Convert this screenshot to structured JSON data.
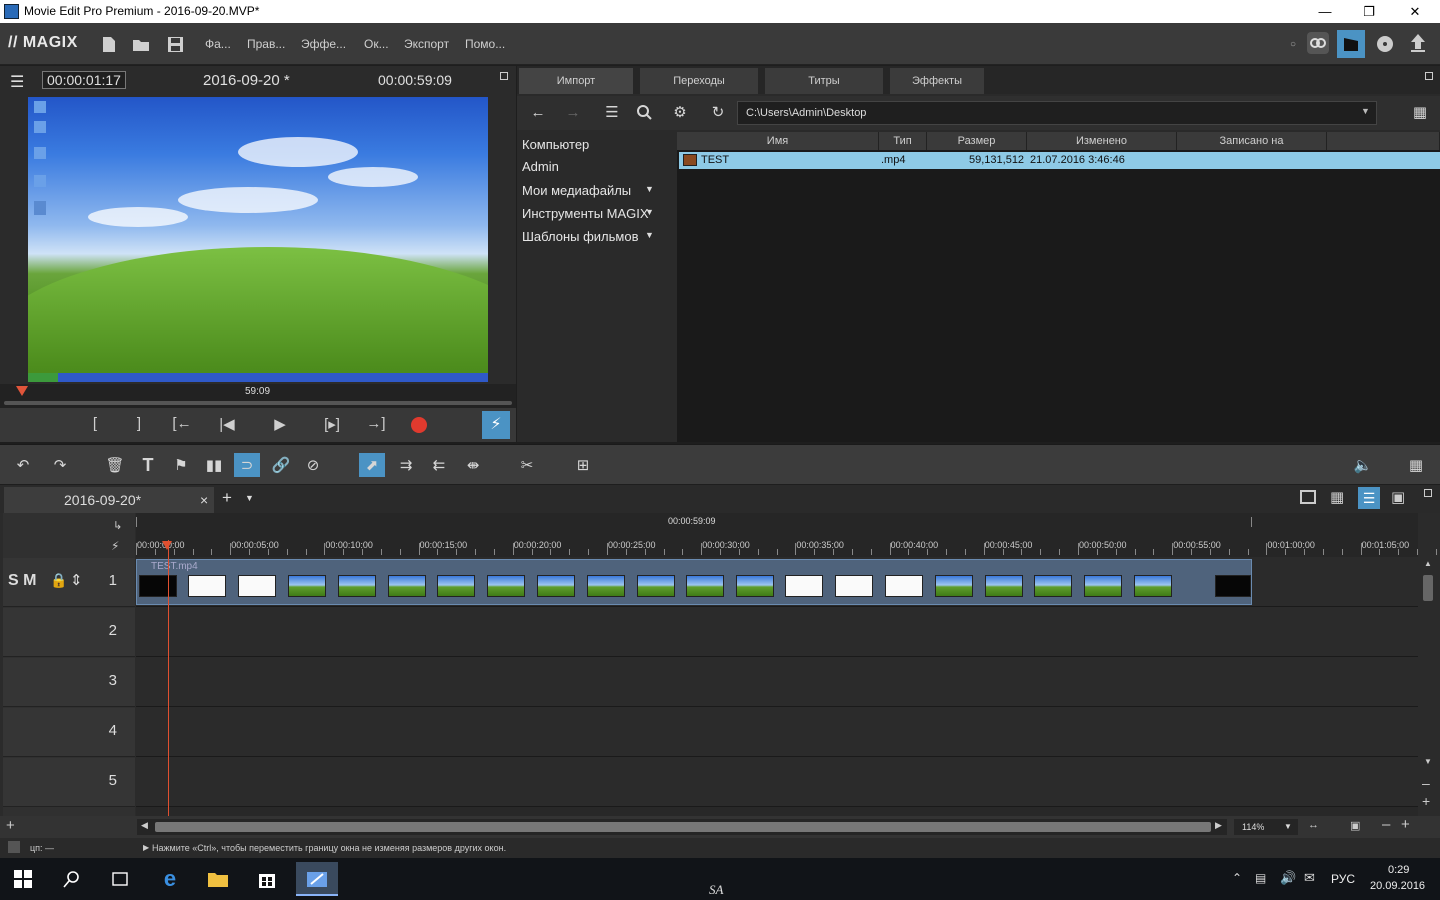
{
  "window": {
    "title": "Movie Edit Pro Premium - 2016-09-20.MVP*"
  },
  "menu": {
    "logo": "// MAGIX",
    "items": [
      "Фа...",
      "Прав...",
      "Эффе...",
      "Ок...",
      "Экспорт",
      "Помо..."
    ]
  },
  "monitor": {
    "timecode_current": "00:00:01:17",
    "project_name": "2016-09-20 *",
    "timecode_total": "00:00:59:09",
    "scrub_label": "59:09"
  },
  "browser": {
    "tabs": [
      "Импорт",
      "Переходы",
      "Титры",
      "Эффекты"
    ],
    "path": "C:\\Users\\Admin\\Desktop",
    "tree": [
      "Компьютер",
      "Admin",
      "Мои медиафайлы",
      "Инструменты MAGIX",
      "Шаблоны фильмов"
    ],
    "columns": [
      "Имя",
      "Тип",
      "Размер",
      "Изменено",
      "Записано на"
    ],
    "files": [
      {
        "name": "TEST",
        "type": ".mp4",
        "size": "59,131,512",
        "modified": "21.07.2016 3:46:46",
        "recorded": ""
      }
    ]
  },
  "project_tab": {
    "label": "2016-09-20*",
    "close": "×",
    "add": "+"
  },
  "timeline": {
    "range_label": "00:00:59:09",
    "ruler": [
      "00:00:00:00",
      "00:00:05:00",
      "00:00:10:00",
      "00:00:15:00",
      "00:00:20:00",
      "00:00:25:00",
      "00:00:30:00",
      "00:00:35:00",
      "00:00:40:00",
      "00:00:45:00",
      "00:00:50:00",
      "00:00:55:00",
      "00:01:00:00",
      "00:01:05:00"
    ],
    "tracks": [
      "1",
      "2",
      "3",
      "4",
      "5"
    ],
    "track1_controls": "S M",
    "clip_name": "TEST.mp4",
    "zoom": "114%"
  },
  "status": {
    "left": "цп:  —",
    "message": "Нажмите «Ctrl», чтобы переместить границу окна не изменяя размеров других окон."
  },
  "taskbar": {
    "lang": "РУС",
    "time": "0:29",
    "date": "20.09.2016",
    "watermark": "SA"
  }
}
